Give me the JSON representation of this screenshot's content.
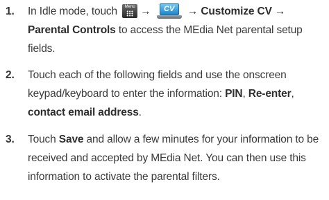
{
  "steps": [
    {
      "number": "1.",
      "parts": {
        "a": "In Idle mode, touch",
        "arrow1": "→",
        "arrow2": "→",
        "b": "→ Customize CV →",
        "c": "Parental Controls",
        "d": " to access the MEdia Net parental setup fields."
      }
    },
    {
      "number": "2.",
      "parts": {
        "a": "Touch each of the following fields and use the onscreen keypad/keyboard to enter the information: ",
        "b": "PIN",
        "c": ", ",
        "d": "Re-enter",
        "e": ", ",
        "f": "contact email address",
        "g": "."
      }
    },
    {
      "number": "3.",
      "parts": {
        "a": "Touch ",
        "b": "Save",
        "c": " and allow a few minutes for your information to be received and accepted by MEdia Net. You can then use this information to activate the parental filters."
      }
    }
  ],
  "icons": {
    "menu_label": "Menu",
    "cv_label": "CV"
  }
}
